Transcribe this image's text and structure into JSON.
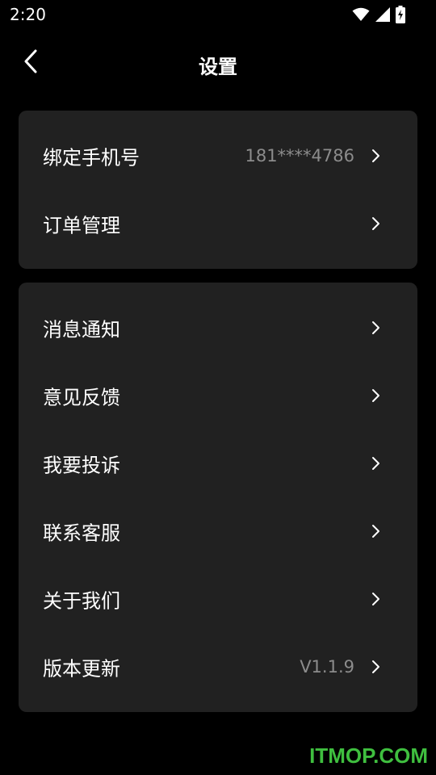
{
  "status_bar": {
    "time": "2:20",
    "icons": [
      "wifi-icon",
      "signal-icon",
      "battery-icon"
    ]
  },
  "header": {
    "title": "设置",
    "back_icon": "chevron-left-icon"
  },
  "group_1": [
    {
      "label": "绑定手机号",
      "value": "181****4786"
    },
    {
      "label": "订单管理",
      "value": ""
    }
  ],
  "group_2": [
    {
      "label": "消息通知",
      "value": ""
    },
    {
      "label": "意见反馈",
      "value": ""
    },
    {
      "label": "我要投诉",
      "value": ""
    },
    {
      "label": "联系客服",
      "value": ""
    },
    {
      "label": "关于我们",
      "value": ""
    },
    {
      "label": "版本更新",
      "value": "V1.1.9"
    }
  ],
  "watermark": "ITMOP.COM",
  "colors": {
    "background": "#000000",
    "card": "#212121",
    "secondary_text": "#8c8c8c",
    "watermark": "#3fbf3f"
  }
}
